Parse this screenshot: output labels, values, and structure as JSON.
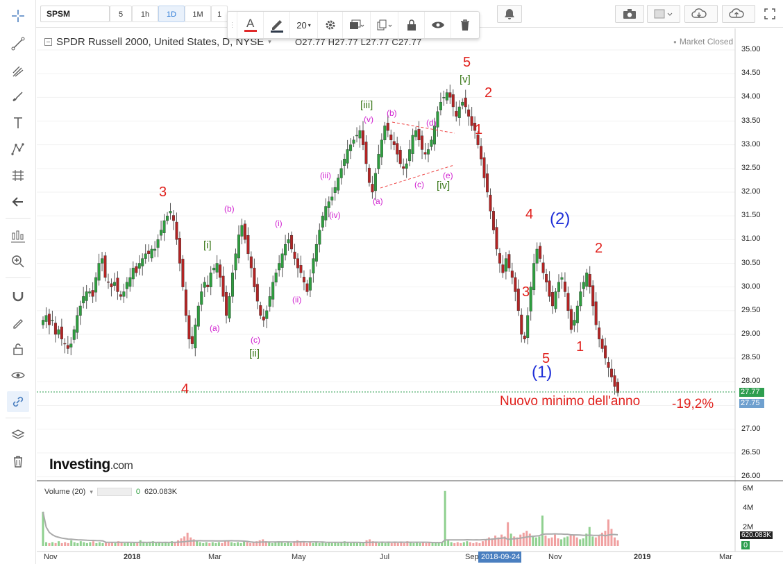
{
  "toolbar": {
    "symbol": "SPSM",
    "timeframes": [
      "5",
      "1h",
      "1D",
      "1M",
      "1"
    ],
    "active_timeframe": "1D"
  },
  "drawing_toolbar": {
    "font_size": "20"
  },
  "chart_header": {
    "title": "SPDR Russell 2000, United States, D, NYSE",
    "ohlc": "O27.77  H27.77  L27.77  C27.77",
    "status": "Market Closed"
  },
  "price_axis": [
    "35.00",
    "34.50",
    "34.00",
    "33.50",
    "33.00",
    "32.50",
    "32.00",
    "31.50",
    "31.00",
    "30.50",
    "30.00",
    "29.50",
    "29.00",
    "28.50",
    "28.00",
    "27.50",
    "27.00",
    "26.50",
    "26.00"
  ],
  "price_tags": {
    "last": "27.77",
    "cursor": "27.75",
    "last_color": "#2e9e4f",
    "cursor_color": "#6fa0cf"
  },
  "time_axis": [
    "Nov",
    "2018",
    "Mar",
    "May",
    "Jul",
    "Sep",
    "Nov",
    "2019",
    "Mar"
  ],
  "time_cursor": "2018-09-24",
  "volume": {
    "legend": "Volume (20)",
    "zero": "0",
    "value": "620.083K",
    "axis": [
      "6M",
      "4M",
      "2M",
      "620.083K",
      "0"
    ]
  },
  "annotation": {
    "text": "Nuovo minimo dell'anno",
    "pct": "-19,2%"
  },
  "logo": {
    "main": "Investing",
    "suffix": ".com"
  },
  "waves": {
    "red": [
      "3",
      "4",
      "5",
      "2",
      "1",
      "4",
      "3",
      "5",
      "2",
      "1"
    ],
    "blue": [
      "(2)",
      "(1)"
    ],
    "green": [
      "[i]",
      "[ii]",
      "[iii]",
      "[iv]",
      "[v]"
    ],
    "magenta": [
      "(a)",
      "(b)",
      "(c)",
      "(i)",
      "(ii)",
      "(iii)",
      "(iv)",
      "(v)",
      "(a)",
      "(b)",
      "(c)",
      "(d)",
      "(e)"
    ]
  },
  "colors": {
    "up": "#2e9e3f",
    "down": "#b22424",
    "wave_red": "#e0201c",
    "wave_blue": "#1f2fd8",
    "wave_green": "#3d7a1c",
    "wave_magenta": "#d020d0"
  },
  "chart_data": {
    "type": "candlestick",
    "ylim": [
      25.9,
      35.2
    ],
    "closes": [
      29.3,
      29.4,
      29.2,
      29.3,
      29.0,
      29.1,
      28.9,
      28.8,
      28.7,
      28.8,
      29.1,
      29.4,
      29.6,
      29.8,
      29.9,
      29.9,
      29.8,
      30.2,
      30.5,
      30.6,
      30.2,
      30.1,
      30.0,
      30.1,
      29.9,
      29.8,
      29.9,
      30.1,
      30.2,
      30.4,
      30.3,
      30.5,
      30.6,
      30.7,
      30.7,
      30.8,
      30.8,
      31.0,
      31.2,
      31.4,
      31.5,
      31.6,
      31.4,
      31.0,
      30.5,
      30.0,
      29.4,
      28.9,
      28.8,
      29.2,
      29.6,
      29.9,
      30.1,
      30.0,
      30.3,
      30.4,
      30.5,
      30.2,
      29.8,
      29.4,
      29.8,
      30.3,
      30.7,
      31.1,
      31.3,
      31.0,
      30.7,
      30.4,
      30.0,
      29.7,
      29.4,
      29.3,
      29.5,
      29.8,
      30.1,
      30.3,
      30.5,
      30.7,
      30.9,
      31.0,
      30.8,
      30.6,
      30.4,
      30.3,
      30.1,
      29.9,
      30.2,
      30.6,
      30.9,
      31.2,
      31.5,
      31.7,
      31.8,
      31.9,
      32.1,
      32.3,
      32.5,
      32.7,
      32.9,
      33.0,
      33.1,
      33.2,
      33.3,
      33.0,
      32.6,
      32.2,
      32.0,
      32.4,
      32.8,
      33.1,
      33.4,
      33.3,
      33.1,
      33.0,
      32.8,
      32.6,
      32.5,
      32.6,
      32.9,
      33.2,
      33.3,
      33.1,
      32.9,
      32.8,
      32.9,
      33.1,
      33.4,
      33.7,
      33.9,
      34.0,
      34.1,
      34.0,
      33.8,
      33.6,
      33.8,
      33.9,
      33.8,
      33.6,
      33.4,
      33.3,
      33.0,
      32.7,
      32.3,
      32.0,
      31.6,
      31.2,
      30.8,
      30.5,
      30.3,
      30.6,
      30.4,
      30.2,
      29.9,
      29.5,
      29.0,
      28.9,
      29.4,
      30.0,
      30.5,
      30.8,
      30.6,
      30.3,
      30.1,
      29.8,
      29.6,
      29.9,
      30.1,
      30.2,
      29.9,
      29.5,
      29.1,
      29.3,
      29.6,
      29.9,
      30.1,
      30.3,
      30.0,
      29.6,
      29.2,
      28.9,
      28.7,
      28.5,
      28.3,
      28.1,
      27.9,
      27.77
    ],
    "volumes_m": [
      3.6,
      0.4,
      0.3,
      0.4,
      0.3,
      0.5,
      0.3,
      0.4,
      0.3,
      0.6,
      0.4,
      0.3,
      0.5,
      0.4,
      0.3,
      0.4,
      0.5,
      0.3,
      0.4,
      0.3,
      0.4,
      0.3,
      0.4,
      0.3,
      0.5,
      0.4,
      0.3,
      0.4,
      0.3,
      0.4,
      0.3,
      0.6,
      0.4,
      0.3,
      0.4,
      0.5,
      0.3,
      0.4,
      0.3,
      0.4,
      0.3,
      0.5,
      0.4,
      0.6,
      0.8,
      1.0,
      1.4,
      0.9,
      0.7,
      0.5,
      0.4,
      0.3,
      0.4,
      0.3,
      0.4,
      0.3,
      0.4,
      0.3,
      0.5,
      0.6,
      0.4,
      0.3,
      0.4,
      0.3,
      0.5,
      0.4,
      0.3,
      0.4,
      0.5,
      0.6,
      0.7,
      0.5,
      0.4,
      0.3,
      0.4,
      0.5,
      0.4,
      0.3,
      0.4,
      0.3,
      0.5,
      0.6,
      0.5,
      0.4,
      0.3,
      0.4,
      0.3,
      0.4,
      0.3,
      0.4,
      0.3,
      0.4,
      0.3,
      0.4,
      0.3,
      0.4,
      0.5,
      0.4,
      0.3,
      0.4,
      0.3,
      0.4,
      0.3,
      0.6,
      0.7,
      0.5,
      0.4,
      0.3,
      0.4,
      0.3,
      0.4,
      0.3,
      0.4,
      0.3,
      0.4,
      0.3,
      0.5,
      0.4,
      0.3,
      0.4,
      0.3,
      0.4,
      0.3,
      0.4,
      0.3,
      0.4,
      0.3,
      0.4,
      5.8,
      0.6,
      0.4,
      0.3,
      0.4,
      0.3,
      0.4,
      0.5,
      0.4,
      0.3,
      0.4,
      0.3,
      0.5,
      0.7,
      0.9,
      0.8,
      1.1,
      0.9,
      1.2,
      1.0,
      2.5,
      1.3,
      1.0,
      0.9,
      1.2,
      1.4,
      1.6,
      1.3,
      1.1,
      0.9,
      1.0,
      3.2,
      1.1,
      0.8,
      0.9,
      1.2,
      0.8,
      0.7,
      0.9,
      1.0,
      1.2,
      1.1,
      0.9,
      0.7,
      0.8,
      1.3,
      2.0,
      1.0,
      0.9,
      1.1,
      1.4,
      1.6,
      2.8,
      1.8,
      0.9,
      0.6
    ]
  }
}
